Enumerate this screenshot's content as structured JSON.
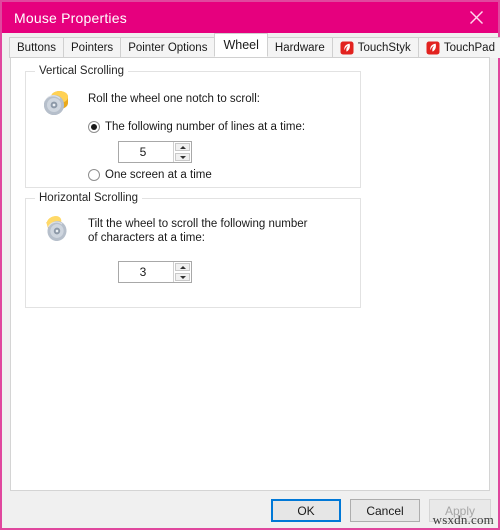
{
  "window": {
    "title": "Mouse Properties",
    "close_icon": "close-icon",
    "accent_color": "#e6007e",
    "border_color": "#e0479e"
  },
  "tabs": [
    {
      "label": "Buttons",
      "active": false,
      "icon": null
    },
    {
      "label": "Pointers",
      "active": false,
      "icon": null
    },
    {
      "label": "Pointer Options",
      "active": false,
      "icon": null
    },
    {
      "label": "Wheel",
      "active": true,
      "icon": null
    },
    {
      "label": "Hardware",
      "active": false,
      "icon": null
    },
    {
      "label": "TouchStyk",
      "active": false,
      "icon": "trackpoint-icon"
    },
    {
      "label": "TouchPad",
      "active": false,
      "icon": "trackpoint-icon"
    }
  ],
  "vertical_scrolling": {
    "legend": "Vertical Scrolling",
    "icon": "mouse-wheel-icon",
    "description": "Roll the wheel one notch to scroll:",
    "option_lines_label": "The following number of lines at a time:",
    "option_lines_selected": true,
    "lines_value": "5",
    "option_screen_label": "One screen at a time",
    "option_screen_selected": false
  },
  "horizontal_scrolling": {
    "legend": "Horizontal Scrolling",
    "icon": "mouse-tilt-wheel-icon",
    "description": "Tilt the wheel to scroll the following number\nof characters at a time:",
    "characters_value": "3"
  },
  "footer": {
    "ok_label": "OK",
    "cancel_label": "Cancel",
    "apply_label": "Apply",
    "apply_disabled": true,
    "watermark": "wsxdn.com"
  }
}
